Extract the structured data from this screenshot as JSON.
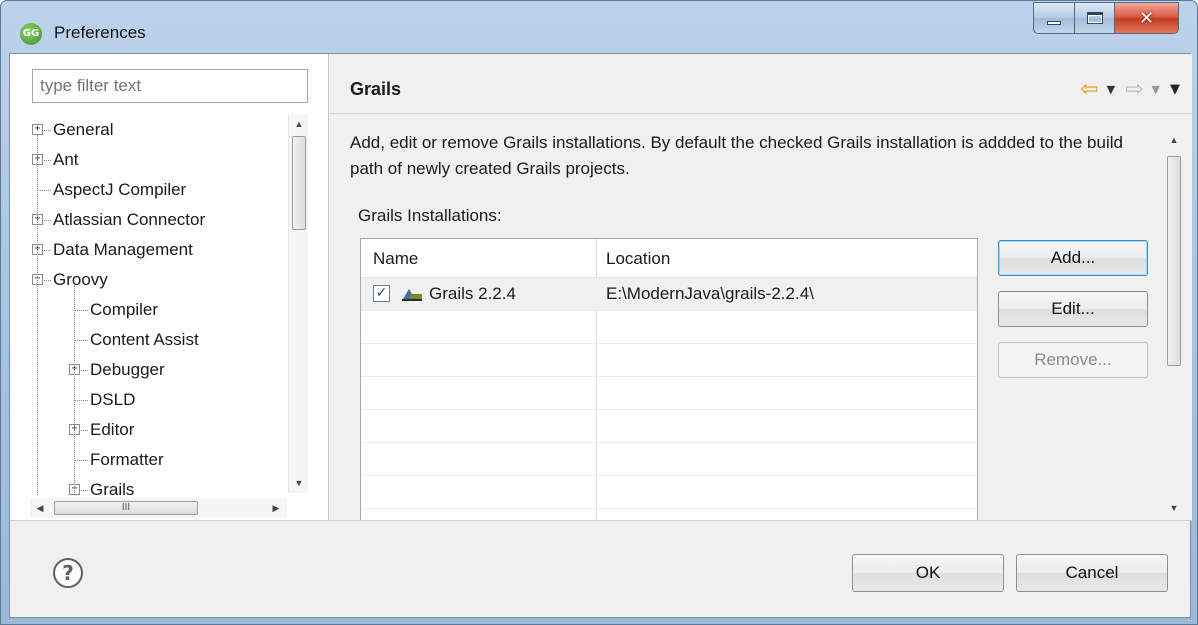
{
  "window": {
    "title": "Preferences",
    "icon_label": "GG",
    "minimize_icon": "minimize-icon",
    "maximize_icon": "maximize-icon",
    "close_glyph": "✕"
  },
  "sidebar": {
    "filter_placeholder": "type filter text",
    "tree": [
      {
        "label": "General",
        "level": 0,
        "expander": "+"
      },
      {
        "label": "Ant",
        "level": 0,
        "expander": "+"
      },
      {
        "label": "AspectJ Compiler",
        "level": 0,
        "expander": ""
      },
      {
        "label": "Atlassian Connector",
        "level": 0,
        "expander": "+"
      },
      {
        "label": "Data Management",
        "level": 0,
        "expander": "+"
      },
      {
        "label": "Groovy",
        "level": 0,
        "expander": "−"
      },
      {
        "label": "Compiler",
        "level": 1,
        "expander": ""
      },
      {
        "label": "Content Assist",
        "level": 1,
        "expander": ""
      },
      {
        "label": "Debugger",
        "level": 1,
        "expander": "+"
      },
      {
        "label": "DSLD",
        "level": 1,
        "expander": ""
      },
      {
        "label": "Editor",
        "level": 1,
        "expander": "+"
      },
      {
        "label": "Formatter",
        "level": 1,
        "expander": ""
      },
      {
        "label": "Grails",
        "level": 1,
        "expander": "−"
      }
    ],
    "h_scroll_thumb": "III"
  },
  "page": {
    "title": "Grails",
    "description": "Add, edit or remove Grails installations. By default the checked Grails installation is addded to the build path of newly created Grails projects.",
    "section_label": "Grails Installations:",
    "table": {
      "columns": [
        "Name",
        "Location"
      ],
      "rows": [
        {
          "checked": true,
          "name": "Grails 2.2.4",
          "location": "E:\\ModernJava\\grails-2.2.4\\"
        }
      ]
    },
    "buttons": {
      "add": "Add...",
      "edit": "Edit...",
      "remove": "Remove..."
    }
  },
  "footer": {
    "help_glyph": "?",
    "ok": "OK",
    "cancel": "Cancel"
  },
  "colors": {
    "title_gradient": "#a9c3e0",
    "back_arrow": "#e0a10c",
    "focus_border": "#3c8fd1",
    "close_button": "#c43a24"
  }
}
